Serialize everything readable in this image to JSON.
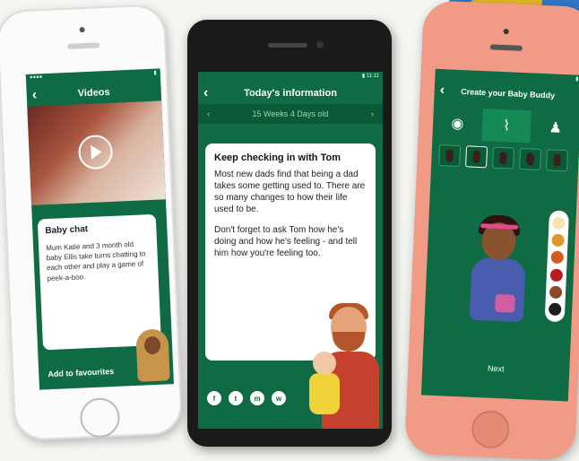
{
  "phone_videos": {
    "title": "Videos",
    "card_title": "Baby chat",
    "card_text": "Mum Katie and 3 month old baby Ellis take turns chatting to each other and play a game of peek-a-boo.",
    "favourites_label": "Add to favourites"
  },
  "phone_info": {
    "title": "Today's information",
    "week_label": "15 Weeks 4 Days old",
    "card_title": "Keep checking in with Tom",
    "paragraph1": "Most new dads find that being a dad takes some getting used to. There are so many changes to how their life used to be.",
    "paragraph2": "Don't forget to ask Tom how he's doing and how he's feeling - and tell him how you're feeling too.",
    "share_icons": [
      "f",
      "t",
      "m",
      "w"
    ]
  },
  "phone_buddy": {
    "title": "Create your Baby Buddy",
    "next_label": "Next",
    "swatch_colors": [
      "#f5e3b0",
      "#e2962e",
      "#d35a1a",
      "#b41e1e",
      "#8a4b24",
      "#1e1e1e"
    ]
  },
  "colors": {
    "app_green": "#0e6b43"
  }
}
